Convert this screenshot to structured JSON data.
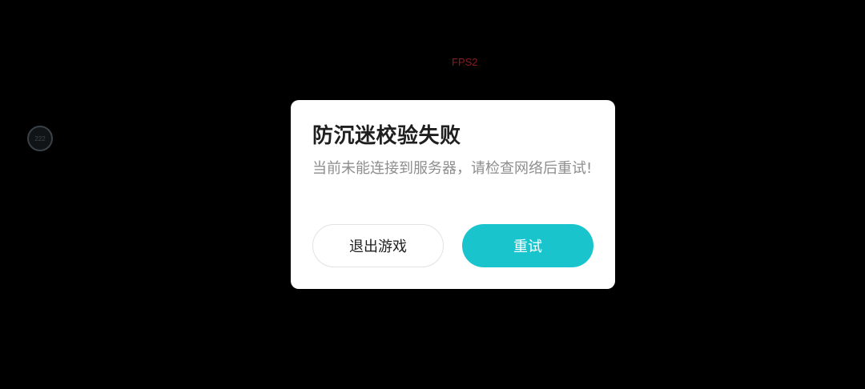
{
  "overlay": {
    "fps_label": "FPS2",
    "float_button_text": "222"
  },
  "dialog": {
    "title": "防沉迷校验失败",
    "message": "当前未能连接到服务器，请检查网络后重试!",
    "exit_label": "退出游戏",
    "retry_label": "重试"
  },
  "colors": {
    "background": "#000000",
    "dialog_bg": "#ffffff",
    "primary_button": "#19c4cc",
    "fps_text": "#8a1c1c",
    "message_text": "#8e8e8e"
  }
}
